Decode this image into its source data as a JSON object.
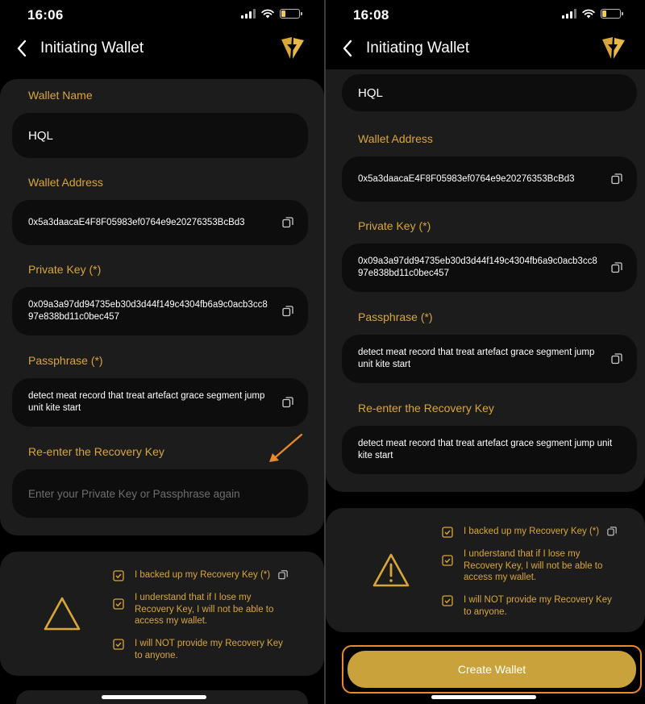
{
  "colors": {
    "background": "#000000",
    "card": "#1c1c1c",
    "field": "#0d0d0d",
    "gold_label": "#d9a63a",
    "button": "#c9a23b",
    "highlight": "#e88a2c"
  },
  "left": {
    "status": {
      "time": "16:06"
    },
    "nav": {
      "title": "Initiating Wallet"
    },
    "form": {
      "wallet_name_label": "Wallet Name",
      "wallet_name_value": "HQL",
      "wallet_address_label": "Wallet Address",
      "wallet_address_value": "0x5a3daacaE4F8F05983ef0764e9e20276353BcBd3",
      "private_key_label": "Private Key (*)",
      "private_key_value": "0x09a3a97dd94735eb30d3d44f149c4304fb6a9c0acb3cc897e838bd11c0bec457",
      "passphrase_label": "Passphrase (*)",
      "passphrase_value": "detect meat record that treat artefact grace segment jump unit kite start",
      "reenter_label": "Re-enter the Recovery Key",
      "reenter_placeholder": "Enter your Private Key or Passphrase again"
    },
    "checks": [
      {
        "label": "I backed up my Recovery Key (*)",
        "checked": true
      },
      {
        "label": "I understand that if I lose my Recovery Key, I will not be able to access my wallet.",
        "checked": true
      },
      {
        "label": "I will NOT provide my Recovery Key to anyone.",
        "checked": true
      }
    ]
  },
  "right": {
    "status": {
      "time": "16:08"
    },
    "nav": {
      "title": "Initiating Wallet"
    },
    "form": {
      "wallet_name_value": "HQL",
      "wallet_address_label": "Wallet Address",
      "wallet_address_value": "0x5a3daacaE4F8F05983ef0764e9e20276353BcBd3",
      "private_key_label": "Private Key (*)",
      "private_key_value": "0x09a3a97dd94735eb30d3d44f149c4304fb6a9c0acb3cc897e838bd11c0bec457",
      "passphrase_label": "Passphrase (*)",
      "passphrase_value": "detect meat record that treat artefact grace segment jump unit kite start",
      "reenter_label": "Re-enter the Recovery Key",
      "reenter_value": "detect meat record that treat artefact grace segment jump unit kite start"
    },
    "checks": [
      {
        "label": "I backed up my Recovery Key (*)",
        "checked": true
      },
      {
        "label": "I understand that if I lose my Recovery Key, I will not be able to access my wallet.",
        "checked": true
      },
      {
        "label": "I will NOT provide my Recovery Key to anyone.",
        "checked": true
      }
    ],
    "create_button_label": "Create Wallet"
  }
}
